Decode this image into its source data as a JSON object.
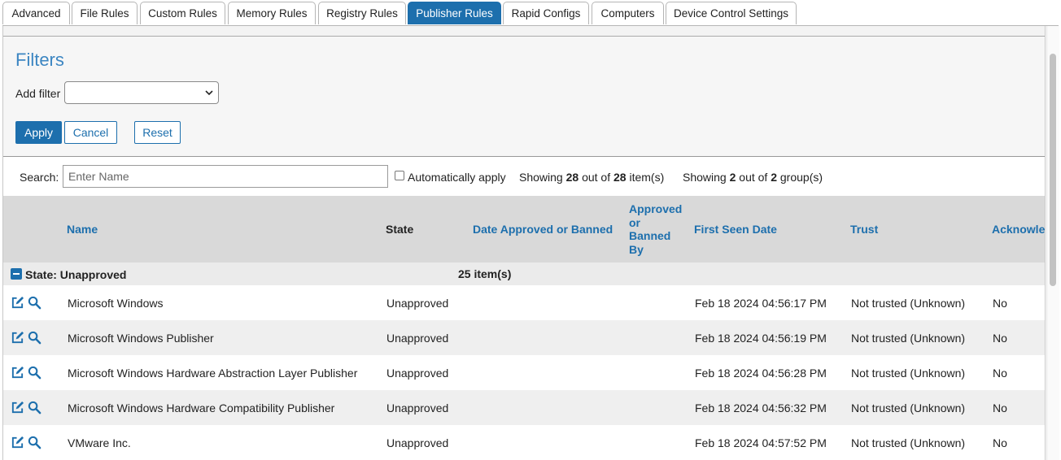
{
  "tabs": [
    {
      "label": "Advanced",
      "active": false
    },
    {
      "label": "File Rules",
      "active": false
    },
    {
      "label": "Custom Rules",
      "active": false
    },
    {
      "label": "Memory Rules",
      "active": false
    },
    {
      "label": "Registry Rules",
      "active": false
    },
    {
      "label": "Publisher Rules",
      "active": true
    },
    {
      "label": "Rapid Configs",
      "active": false
    },
    {
      "label": "Computers",
      "active": false
    },
    {
      "label": "Device Control Settings",
      "active": false
    }
  ],
  "filters": {
    "title": "Filters",
    "add_filter_label": "Add filter",
    "add_filter_value": "",
    "apply_label": "Apply",
    "cancel_label": "Cancel",
    "reset_label": "Reset"
  },
  "search": {
    "label": "Search:",
    "placeholder": "Enter Name",
    "value": "",
    "auto_apply_label": "Automatically apply",
    "auto_apply_checked": false,
    "items_prefix": "Showing",
    "items_shown": "28",
    "items_mid": "out of",
    "items_total": "28",
    "items_suffix": "item(s)",
    "groups_prefix": "Showing",
    "groups_shown": "2",
    "groups_mid": "out of",
    "groups_total": "2",
    "groups_suffix": "group(s)"
  },
  "table": {
    "columns": {
      "name": "Name",
      "state": "State",
      "date_approved": "Date Approved or Banned",
      "approved_by_1": "Approved",
      "approved_by_2": "or",
      "approved_by_3": "Banned",
      "approved_by_4": "By",
      "first_seen": "First Seen Date",
      "trust": "Trust",
      "acknowledged": "Acknowledged"
    },
    "group": {
      "label": "State: Unapproved",
      "count": "25 item(s)"
    },
    "rows": [
      {
        "name": "Microsoft Windows",
        "state": "Unapproved",
        "date_approved": "",
        "approved_by": "",
        "first_seen": "Feb 18 2024 04:56:17 PM",
        "trust": "Not trusted (Unknown)",
        "acknowledged": "No"
      },
      {
        "name": "Microsoft Windows Publisher",
        "state": "Unapproved",
        "date_approved": "",
        "approved_by": "",
        "first_seen": "Feb 18 2024 04:56:19 PM",
        "trust": "Not trusted (Unknown)",
        "acknowledged": "No"
      },
      {
        "name": "Microsoft Windows Hardware Abstraction Layer Publisher",
        "state": "Unapproved",
        "date_approved": "",
        "approved_by": "",
        "first_seen": "Feb 18 2024 04:56:28 PM",
        "trust": "Not trusted (Unknown)",
        "acknowledged": "No"
      },
      {
        "name": "Microsoft Windows Hardware Compatibility Publisher",
        "state": "Unapproved",
        "date_approved": "",
        "approved_by": "",
        "first_seen": "Feb 18 2024 04:56:32 PM",
        "trust": "Not trusted (Unknown)",
        "acknowledged": "No"
      },
      {
        "name": "VMware Inc.",
        "state": "Unapproved",
        "date_approved": "",
        "approved_by": "",
        "first_seen": "Feb 18 2024 04:57:52 PM",
        "trust": "Not trusted (Unknown)",
        "acknowledged": "No"
      }
    ]
  },
  "icons": {
    "edit": "edit-icon",
    "details": "magnifier-icon",
    "collapse": "collapse-minus-icon",
    "dropdown": "chevron-down-icon"
  },
  "colors": {
    "accent": "#1d6fad",
    "filters_title": "#3c86c2",
    "header_bg": "#d9d9d9",
    "group_bg": "#ebebeb",
    "alt_row_bg": "#efefef"
  }
}
